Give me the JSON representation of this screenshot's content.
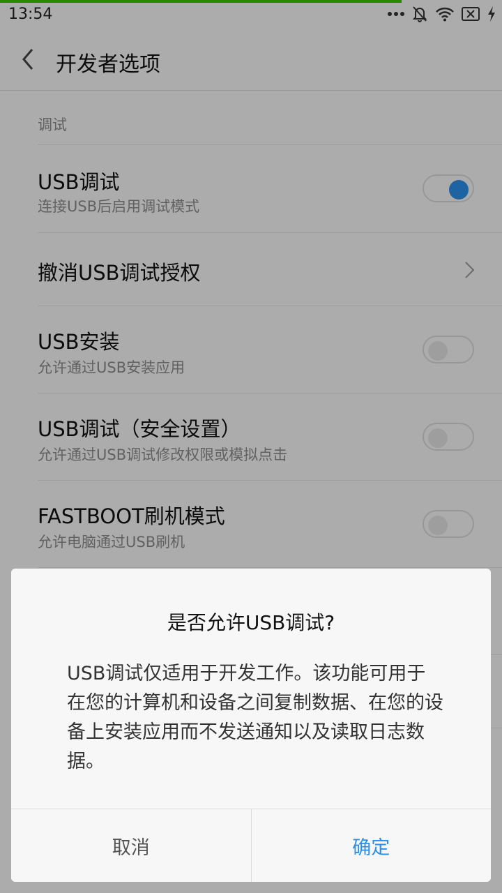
{
  "status_bar": {
    "time": "13:54",
    "loading_progress": 0.8,
    "icons": [
      "more-dots-icon",
      "bell-off-icon",
      "wifi-icon",
      "sim-disabled-icon",
      "charging-icon"
    ]
  },
  "header": {
    "title": "开发者选项",
    "back_icon": "chevron-left-icon"
  },
  "section": {
    "label": "调试"
  },
  "settings": [
    {
      "title": "USB调试",
      "subtitle": "连接USB后启用调试模式",
      "control": "toggle",
      "on": true
    },
    {
      "title": "撤消USB调试授权",
      "subtitle": "",
      "control": "chevron"
    },
    {
      "title": "USB安装",
      "subtitle": "允许通过USB安装应用",
      "control": "toggle",
      "on": false
    },
    {
      "title": "USB调试（安全设置）",
      "subtitle": "允许通过USB调试修改权限或模拟点击",
      "control": "toggle",
      "on": false
    },
    {
      "title": "FASTBOOT刷机模式",
      "subtitle": "允许电脑通过USB刷机",
      "control": "toggle",
      "on": false
    }
  ],
  "dialog": {
    "title": "是否允许USB调试?",
    "message": "USB调试仅适用于开发工作。该功能可用于在您的计算机和设备之间复制数据、在您的设备上安装应用而不发送通知以及读取日志数据。",
    "cancel_label": "取消",
    "confirm_label": "确定"
  },
  "colors": {
    "accent": "#2b8ee8",
    "progress": "#39c400",
    "background": "#f7f7f7"
  }
}
